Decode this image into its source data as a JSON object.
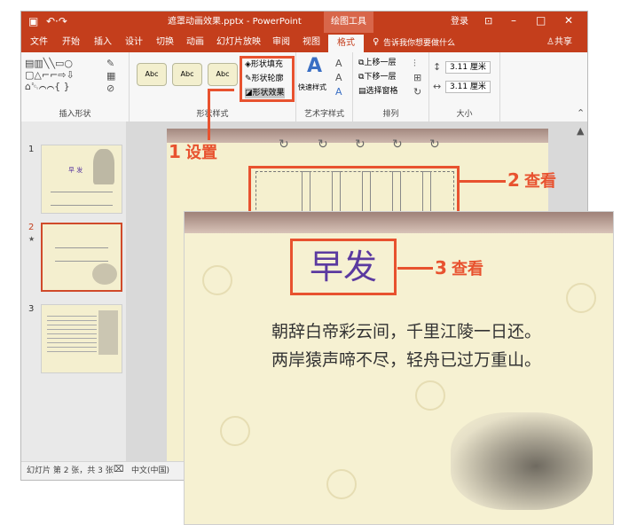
{
  "titlebar": {
    "document_title": "遮罩动画效果.pptx - PowerPoint",
    "context_tab": "绘图工具",
    "login": "登录",
    "qat_undo_redo": "↶·↷"
  },
  "tabs": [
    "文件",
    "开始",
    "插入",
    "设计",
    "切换",
    "动画",
    "幻灯片放映",
    "审阅",
    "视图",
    "格式"
  ],
  "active_tab": "格式",
  "tell_me": "告诉我你想要做什么",
  "share": "共享",
  "ribbon": {
    "insert_shapes_label": "插入形状",
    "shape_styles_label": "形状样式",
    "style_sample": "Abc",
    "shape_fill": "形状填充",
    "shape_outline": "形状轮廓",
    "shape_effects": "形状效果",
    "quick_styles": "快速样式",
    "wordart_label": "艺术字样式",
    "bring_forward": "上移一层",
    "send_backward": "下移一层",
    "selection_pane": "选择窗格",
    "arrange_label": "排列",
    "height": "3.11 厘米",
    "width": "3.11 厘米",
    "size_label": "大小"
  },
  "thumbnails": [
    "1",
    "2",
    "3"
  ],
  "thumb_star": "★",
  "thumb1_title": "早 发",
  "statusbar": {
    "slide_info": "幻灯片 第 2 张，共 3 张",
    "language": "中文(中国)"
  },
  "callouts": {
    "c1_num": "1",
    "c1_text": "设置",
    "c2_num": "2",
    "c2_text": "查看",
    "c3_num": "3",
    "c3_text": "查看"
  },
  "poem": {
    "title": "早发",
    "line1": "朝辞白帝彩云间，千里江陵一日还。",
    "line2": "两岸猿声啼不尽，轻舟已过万重山。"
  },
  "colors": {
    "accent": "#c43e1c",
    "callout": "#e8522f",
    "title": "#5b3aa0"
  }
}
